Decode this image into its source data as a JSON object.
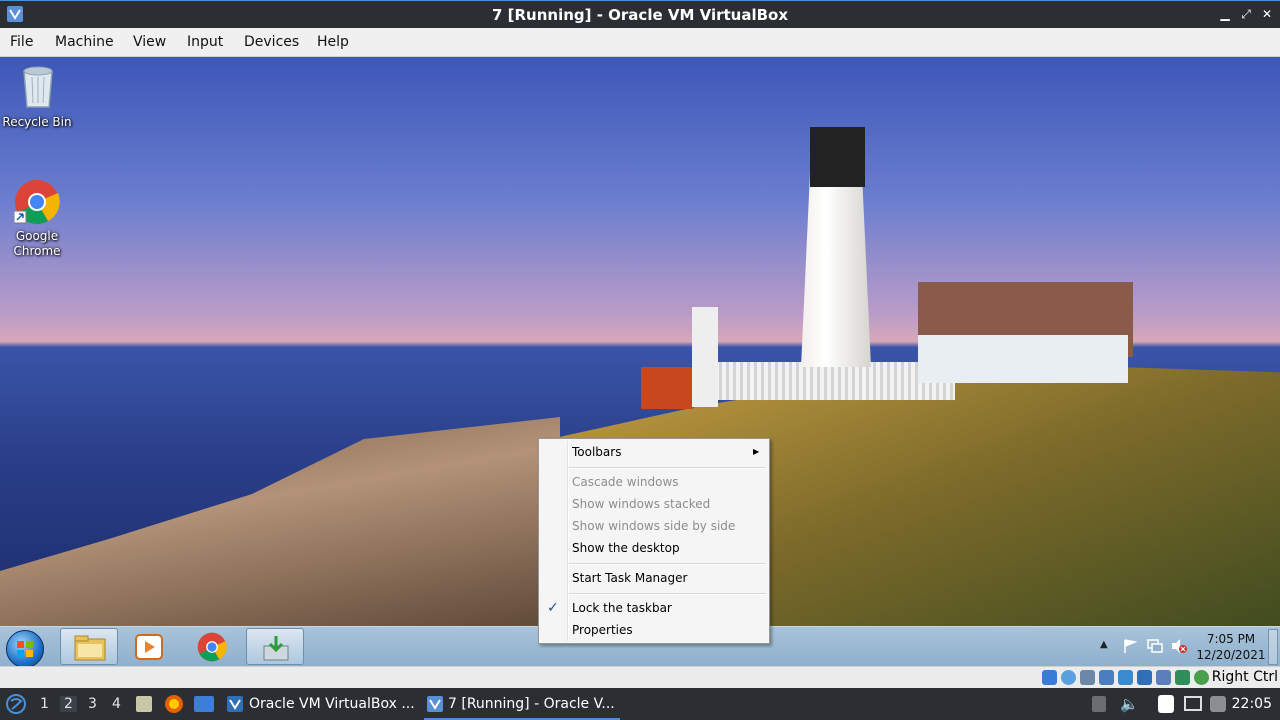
{
  "window": {
    "title": "7 [Running] - Oracle VM VirtualBox",
    "controls": [
      "minimize-icon",
      "maximize-icon",
      "close-icon"
    ]
  },
  "menubar": {
    "items": [
      "File",
      "Machine",
      "View",
      "Input",
      "Devices",
      "Help"
    ]
  },
  "desktop": {
    "icons": [
      {
        "label_line1": "Recycle Bin",
        "label_line2": "",
        "icon": "recycle-bin-icon"
      },
      {
        "label_line1": "Google",
        "label_line2": "Chrome",
        "icon": "chrome-icon"
      }
    ]
  },
  "context_menu": {
    "items": [
      {
        "label": "Toolbars",
        "enabled": true,
        "submenu": true
      },
      {
        "label": "Cascade windows",
        "enabled": false
      },
      {
        "label": "Show windows stacked",
        "enabled": false
      },
      {
        "label": "Show windows side by side",
        "enabled": false
      },
      {
        "label": "Show the desktop",
        "enabled": true
      },
      {
        "label": "Start Task Manager",
        "enabled": true
      },
      {
        "label": "Lock the taskbar",
        "enabled": true,
        "checked": true
      },
      {
        "label": "Properties",
        "enabled": true
      }
    ]
  },
  "guest_taskbar": {
    "pinned": [
      "file-explorer-icon",
      "media-player-icon",
      "chrome-icon",
      "installer-icon"
    ],
    "clock_time": "7:05 PM",
    "clock_date": "12/20/2021"
  },
  "vbox_status": {
    "host_key": "Right Ctrl"
  },
  "host_panel": {
    "workspaces": [
      "1",
      "2",
      "3",
      "4"
    ],
    "current_workspace": "2",
    "tasks": [
      {
        "label": "Oracle VM VirtualBox ..."
      },
      {
        "label": "7 [Running] - Oracle V..."
      }
    ],
    "clock": "22:05"
  },
  "colors": {
    "accent": "#4a90d9",
    "host_bar": "#2b2e33",
    "menu_disabled": "#8d8d8d"
  }
}
